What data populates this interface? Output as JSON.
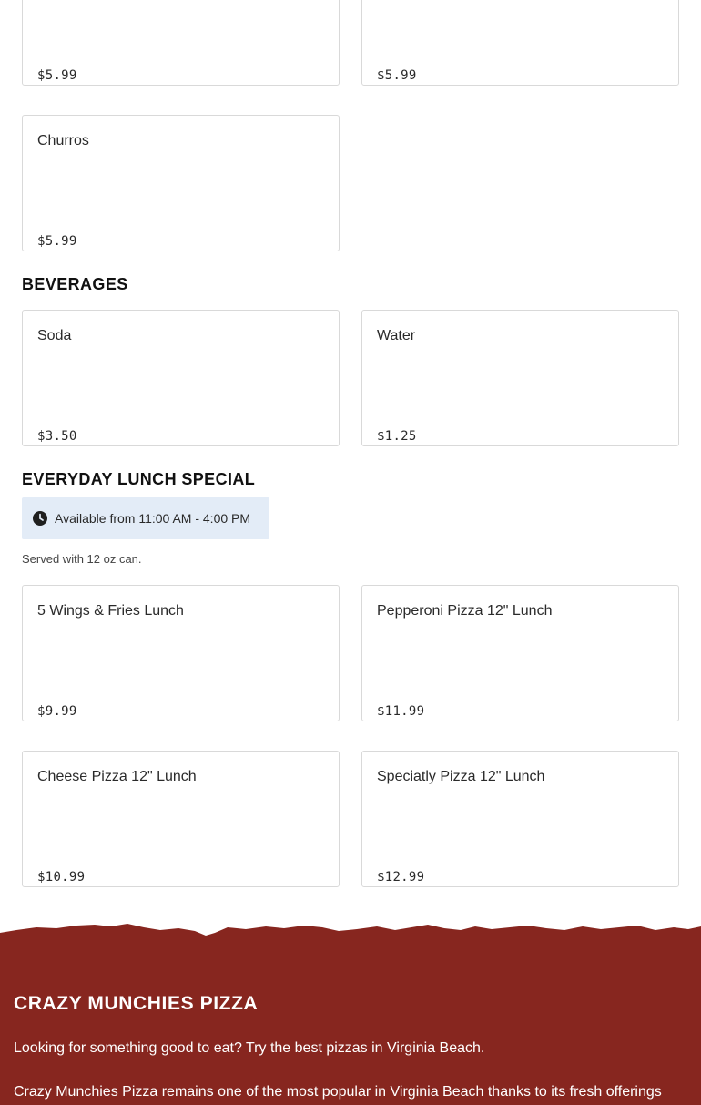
{
  "top_partial_items": [
    {
      "name": "",
      "price": "$5.99"
    },
    {
      "name": "",
      "price": "$5.99"
    }
  ],
  "desserts_items": [
    {
      "name": "Churros",
      "price": "$5.99"
    }
  ],
  "beverages": {
    "title": "BEVERAGES",
    "items": [
      {
        "name": "Soda",
        "price": "$3.50"
      },
      {
        "name": "Water",
        "price": "$1.25"
      }
    ]
  },
  "lunch_special": {
    "title": "EVERYDAY LUNCH SPECIAL",
    "availability": "Available from 11:00 AM - 4:00 PM",
    "availability_icon": "clock-icon",
    "description": "Served with 12 oz can.",
    "items": [
      {
        "name": "5 Wings & Fries Lunch",
        "price": "$9.99"
      },
      {
        "name": "Pepperoni Pizza 12\" Lunch",
        "price": "$11.99"
      },
      {
        "name": "Cheese Pizza 12\" Lunch",
        "price": "$10.99"
      },
      {
        "name": "Speciatly Pizza 12\" Lunch",
        "price": "$12.99"
      }
    ]
  },
  "footer": {
    "title": "CRAZY MUNCHIES PIZZA",
    "paragraph_1": "Looking for something good to eat? Try the best pizzas in Virginia Beach.",
    "paragraph_2": "Crazy Munchies Pizza remains one of the most popular in Virginia Beach thanks to its fresh offerings",
    "background_color": "#87261f",
    "text_color": "#ffffff"
  },
  "colors": {
    "card_border": "#d9d9d9",
    "availability_bg": "#e3ecf7"
  }
}
